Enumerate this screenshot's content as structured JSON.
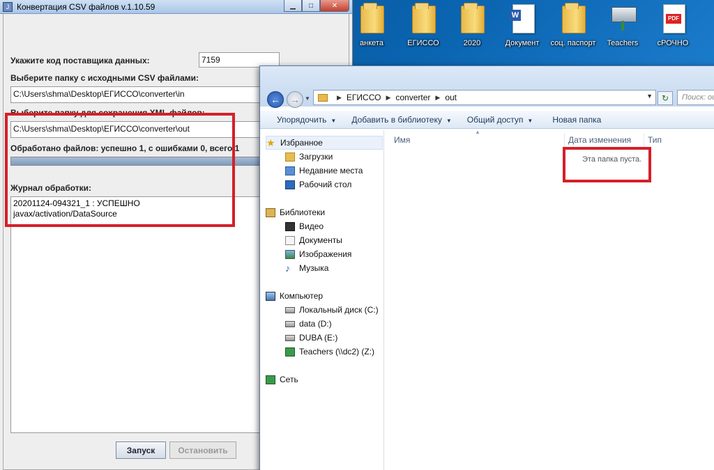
{
  "desktop": {
    "icons": [
      {
        "label": "анкета",
        "icon": "folder-icon"
      },
      {
        "label": "ЕГИССО",
        "icon": "folder-icon"
      },
      {
        "label": "2020",
        "icon": "folder-icon"
      },
      {
        "label": "Документ",
        "icon": "word-document-icon"
      },
      {
        "label": "соц. паспорт",
        "icon": "folder-icon"
      },
      {
        "label": "Teachers",
        "icon": "network-drive-icon"
      },
      {
        "label": "сРОЧНО",
        "icon": "pdf-icon"
      }
    ]
  },
  "converter": {
    "title": "Конвертация CSV файлов v.1.10.59",
    "supplier_code_label": "Укажите код поставщика данных:",
    "supplier_code_value": "7159",
    "source_folder_label": "Выберите папку с исходными CSV файлами:",
    "source_folder_value": "C:\\Users\\shma\\Desktop\\ЕГИССО\\converter\\in",
    "output_folder_label": "Выберите папку для сохранения XML файлов:",
    "output_folder_value": "C:\\Users\\shma\\Desktop\\ЕГИССО\\converter\\out",
    "status_text": "Обработано файлов: успешно 1, с ошибками 0, всего 1",
    "progress_fraction": 1.0,
    "log_label": "Журнал обработки:",
    "log_lines": [
      "20201124-094321_1 : УСПЕШНО",
      "javax/activation/DataSource"
    ],
    "start_button": "Запуск",
    "stop_button": "Остановить",
    "highlight_color": "#d4202a"
  },
  "explorer": {
    "breadcrumb": [
      "ЕГИССО",
      "converter",
      "out"
    ],
    "search_placeholder": "Поиск: out",
    "toolbar": [
      {
        "label": "Упорядочить",
        "dropdown": true
      },
      {
        "label": "Добавить в библиотеку",
        "dropdown": true
      },
      {
        "label": "Общий доступ",
        "dropdown": true
      },
      {
        "label": "Новая папка",
        "dropdown": false
      }
    ],
    "nav": {
      "favorites": {
        "label": "Избранное",
        "items": [
          "Загрузки",
          "Недавние места",
          "Рабочий стол"
        ]
      },
      "libraries": {
        "label": "Библиотеки",
        "items": [
          "Видео",
          "Документы",
          "Изображения",
          "Музыка"
        ]
      },
      "computer": {
        "label": "Компьютер",
        "items": [
          "Локальный диск (C:)",
          "data (D:)",
          "DUBA (E:)",
          "Teachers (\\\\dc2) (Z:)"
        ]
      },
      "network": {
        "label": "Сеть"
      }
    },
    "columns": [
      "Имя",
      "Дата изменения",
      "Тип"
    ],
    "empty_message": "Эта папка пуста."
  }
}
